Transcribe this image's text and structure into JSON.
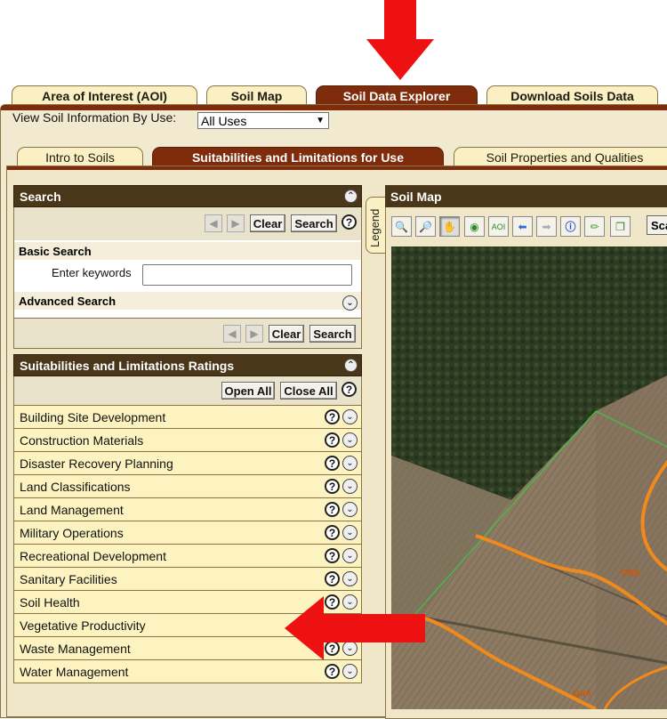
{
  "top_tabs": [
    {
      "label": "Area of Interest (AOI)",
      "active": false
    },
    {
      "label": "Soil Map",
      "active": false
    },
    {
      "label": "Soil Data Explorer",
      "active": true
    },
    {
      "label": "Download Soils Data",
      "active": false
    }
  ],
  "view_by": {
    "label": "View Soil Information By Use:",
    "selected": "All Uses"
  },
  "sub_tabs": [
    {
      "label": "Intro to Soils",
      "active": false
    },
    {
      "label": "Suitabilities and Limitations for Use",
      "active": true
    },
    {
      "label": "Soil Properties and Qualities",
      "active": false
    }
  ],
  "search_panel": {
    "title": "Search",
    "clear_label": "Clear",
    "search_label": "Search",
    "basic_search": "Basic Search",
    "keywords_label": "Enter keywords",
    "keywords_value": "",
    "advanced_search": "Advanced Search"
  },
  "ratings_panel": {
    "title": "Suitabilities and Limitations Ratings",
    "open_all": "Open All",
    "close_all": "Close All",
    "items": [
      "Building Site Development",
      "Construction Materials",
      "Disaster Recovery Planning",
      "Land Classifications",
      "Land Management",
      "Military Operations",
      "Recreational Development",
      "Sanitary Facilities",
      "Soil Health",
      "Vegetative Productivity",
      "Waste Management",
      "Water Management"
    ]
  },
  "legend_tab": "Legend",
  "map_panel": {
    "title": "Soil Map",
    "scale_label": "Sca",
    "labels": [
      "CRA",
      "QuA"
    ],
    "tool_icons": [
      "zoom-in-icon",
      "zoom-out-icon",
      "pan-icon",
      "globe-icon",
      "aoi-icon",
      "back-icon",
      "forward-icon",
      "info-icon",
      "measure-icon",
      "copy-icon"
    ]
  },
  "colors": {
    "accent_tab": "#7e2c0c",
    "panel_header": "#4a3719",
    "rating_row": "#fcf3c0",
    "annotation_arrow": "#ee1111",
    "soil_line": "#f08a1c"
  }
}
